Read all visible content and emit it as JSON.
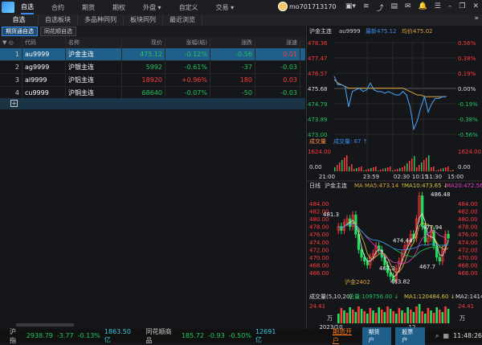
{
  "topbar": {
    "nav": [
      "自选",
      "合约",
      "期货",
      "期权",
      "外盘 ▾",
      "自定义",
      "交易 ▾"
    ],
    "user": "mo701713170",
    "tools": [
      "▣▾",
      "≋",
      "⤴",
      "▤",
      "✉",
      "🔔",
      "☰",
      "–",
      "❐",
      "✕"
    ]
  },
  "subtabs": [
    "自选",
    "自选板块",
    "多品种同列",
    "板块同列",
    "最近浏览"
  ],
  "groups": [
    "期货通自选",
    "同花顺自选"
  ],
  "table": {
    "headers": [
      "",
      "代码",
      "名称",
      "现价",
      "涨幅(结)",
      "涨跌",
      "涨速"
    ],
    "rows": [
      {
        "idx": "1",
        "code": "au9999",
        "name": "沪金主连",
        "price": "475.12",
        "pct": "-0.12%",
        "chg": "-0.56",
        "speed": "0.01",
        "pc": "green",
        "sc": "red"
      },
      {
        "idx": "2",
        "code": "ag9999",
        "name": "沪银主连",
        "price": "5992",
        "pct": "-0.61%",
        "chg": "-37",
        "speed": "-0.03",
        "pc": "green",
        "sc": "green"
      },
      {
        "idx": "3",
        "code": "al9999",
        "name": "沪铝主连",
        "price": "18920",
        "pct": "+0.96%",
        "chg": "180",
        "speed": "0.03",
        "pc": "red",
        "sc": "red"
      },
      {
        "idx": "4",
        "code": "cu9999",
        "name": "沪铜主连",
        "price": "68640",
        "pct": "-0.07%",
        "chg": "-50",
        "speed": "-0.03",
        "pc": "green",
        "sc": "green"
      }
    ]
  },
  "intraday": {
    "name": "沪金主连",
    "code": "au9999",
    "latest": "最新475.12",
    "avg": "均价475.02",
    "left_ticks": [
      "478.36",
      "477.47",
      "476.57",
      "475.68",
      "474.79",
      "473.89",
      "473.00"
    ],
    "right_ticks": [
      "0.56%",
      "0.38%",
      "0.19%",
      "0.00%",
      "-0.19%",
      "-0.38%",
      "-0.56%"
    ],
    "volume_label": "成交量",
    "volume_value": "成交量: 67 ↑",
    "vol_ticks": [
      "1624.00",
      "0.00"
    ],
    "time_ticks": [
      "21:00",
      "23:59",
      "02:30",
      "10:15",
      "11:30",
      "15:00"
    ],
    "prices": [
      476.4,
      475.9,
      475.9,
      475.8,
      474.6,
      475.5,
      475.6,
      475.7,
      475.5,
      475.6,
      476.0,
      475.6,
      475.5,
      475.5,
      475.4,
      475.5,
      475.4,
      475.3,
      475.3,
      475.5,
      475.3,
      474.6,
      473.3,
      473.8,
      474.6,
      475.2,
      474.3,
      474.8,
      475.1,
      475.1,
      475.2,
      475.2
    ],
    "avg_prices": [
      476.2,
      476.0,
      475.9,
      475.8,
      475.7,
      475.7,
      475.7,
      475.7,
      475.7,
      475.7,
      475.7,
      475.7,
      475.7,
      475.7,
      475.7,
      475.7,
      475.7,
      475.7,
      475.7,
      475.7,
      475.6,
      475.5,
      475.4,
      475.3,
      475.3,
      475.2,
      475.2,
      475.2,
      475.2,
      475.2,
      475.2,
      475.2
    ]
  },
  "daily": {
    "label": "日线",
    "name": "沪金主连",
    "ma5": "MA MA5:473.14 ↑",
    "ma10": "MA10:473.65 ↓",
    "ma20": "MA20:472.56",
    "ticks": [
      "484.00",
      "482.00",
      "480.00",
      "478.00",
      "476.00",
      "474.00",
      "472.00",
      "470.00",
      "468.00",
      "466.00"
    ],
    "annotations": [
      "481.3",
      "486.48",
      "474.44",
      "477.94",
      "467.3",
      "467.7",
      "463.82"
    ],
    "contract": "沪金2402",
    "closes": [
      478,
      477,
      479,
      480,
      478,
      481,
      476,
      472,
      470,
      469,
      468,
      470,
      471,
      473,
      472,
      470,
      468,
      466,
      465,
      464,
      467,
      469,
      471,
      473,
      474,
      476,
      475,
      480,
      486,
      478,
      474,
      475,
      477,
      473,
      470,
      469,
      472,
      476,
      475
    ],
    "vol_header": "成交量(5,10,20)",
    "vol_total": "总量:109756.00 ↓",
    "vol_ma1": "MA1:120484.60 ↓",
    "vol_ma2": "MA2:14141",
    "vol_tick": "24.41",
    "vol_unit": "万",
    "dates": [
      "2023/10",
      "12"
    ]
  },
  "statusbar": {
    "idx1": "沪指",
    "v1": "2938.79",
    "c1": "-3.77",
    "p1": "-0.13%",
    "a1": "1863.50亿",
    "idx2": "同花顺商品",
    "v2": "185.72",
    "c2": "-0.93",
    "p2": "-0.50%",
    "a2": "12691亿",
    "open_account": "期货开户",
    "btn1": "期货户",
    "btn2": "股票户",
    "time": "11:48:26"
  },
  "colors": {
    "up": "#ff3b3b",
    "down": "#22c55e",
    "accent": "#3a8ee8",
    "bg": "#15161a"
  }
}
